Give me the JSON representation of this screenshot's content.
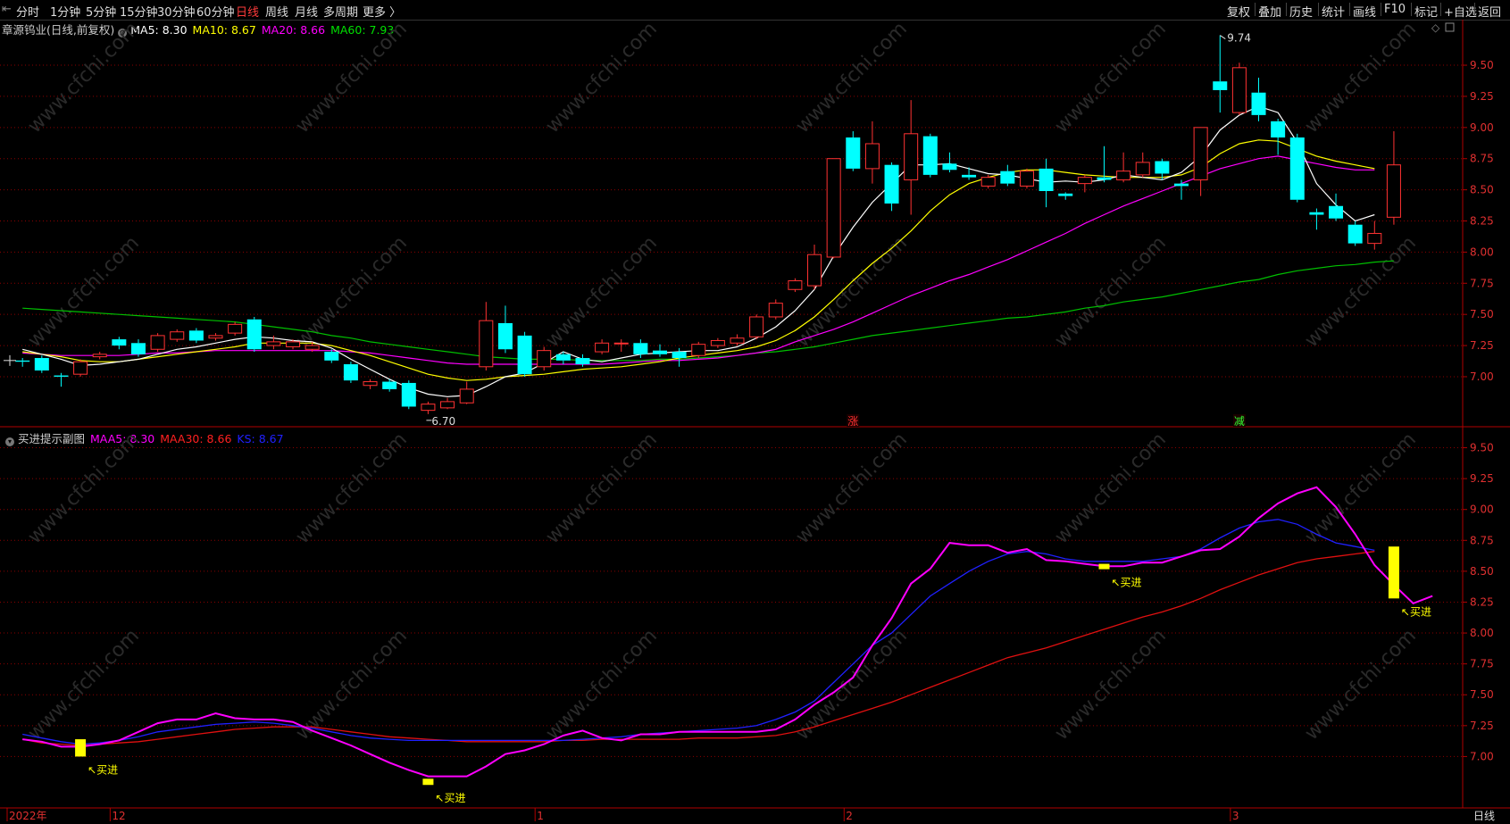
{
  "toolbar": {
    "left_tabs": [
      "分时",
      "1分钟",
      "5分钟",
      "15分钟",
      "30分钟",
      "60分钟",
      "日线",
      "周线",
      "月线",
      "多周期",
      "更多 〉"
    ],
    "active_tab": "日线",
    "right_tabs": [
      "复权",
      "叠加",
      "历史",
      "统计",
      "画线",
      "F10",
      "标记",
      "+自选",
      "返回"
    ]
  },
  "main_chart": {
    "stock_name": "章源钨业(日线,前复权)",
    "ma_labels": [
      {
        "text": "MA5: 8.30",
        "color": "#ffffff"
      },
      {
        "text": "MA10: 8.67",
        "color": "#ffff00"
      },
      {
        "text": "MA20: 8.66",
        "color": "#ff00ff"
      },
      {
        "text": "MA60: 7.93",
        "color": "#00e000"
      }
    ],
    "high_label": "9.74",
    "low_label": "6.70",
    "markers": [
      {
        "text": "涨",
        "color": "#ff3030",
        "bar": 43
      },
      {
        "text": "减",
        "color": "#30ff30",
        "bar": 63
      }
    ],
    "y_ticks": [
      "9.50",
      "9.25",
      "9.00",
      "8.75",
      "8.50",
      "8.25",
      "8.00",
      "7.75",
      "7.50",
      "7.25",
      "7.00"
    ],
    "icons": [
      "diamond-icon",
      "window-icon"
    ]
  },
  "sub_chart": {
    "title": "买进提示副图",
    "labels": [
      {
        "text": "MAA5: 8.30",
        "color": "#ff00ff"
      },
      {
        "text": "MAA30: 8.66",
        "color": "#ff2020"
      },
      {
        "text": "KS: 8.67",
        "color": "#2020ff"
      }
    ],
    "y_ticks": [
      "9.50",
      "9.25",
      "9.00",
      "8.75",
      "8.50",
      "8.25",
      "8.00",
      "7.75",
      "7.50",
      "7.25",
      "7.00"
    ],
    "buy_label": "↖买进"
  },
  "x_axis": {
    "labels": [
      {
        "text": "2022年",
        "bar": 0
      },
      {
        "text": "12",
        "bar": 5
      },
      {
        "text": "1",
        "bar": 27
      },
      {
        "text": "2",
        "bar": 43
      },
      {
        "text": "3",
        "bar": 63
      }
    ],
    "period_label": "日线"
  },
  "watermark": "www.cfchi.com",
  "colors": {
    "up": "#ff3232",
    "down": "#00ffff",
    "ma5": "#ffffff",
    "ma10": "#ffff00",
    "ma20": "#ff00ff",
    "ma60": "#00c000",
    "ks": "#2020ff",
    "buy": "#ffff00",
    "grid": "#8b0000"
  },
  "chart_data": {
    "type": "candlestick",
    "candles": [
      {
        "o": 7.13,
        "c": 7.12,
        "h": 7.15,
        "l": 7.08
      },
      {
        "o": 7.15,
        "c": 7.05,
        "h": 7.17,
        "l": 7.03
      },
      {
        "o": 7.01,
        "c": 7.0,
        "h": 7.03,
        "l": 6.92
      },
      {
        "o": 7.02,
        "c": 7.12,
        "h": 7.14,
        "l": 7.0
      },
      {
        "o": 7.16,
        "c": 7.18,
        "h": 7.2,
        "l": 7.14
      },
      {
        "o": 7.3,
        "c": 7.25,
        "h": 7.32,
        "l": 7.22
      },
      {
        "o": 7.27,
        "c": 7.18,
        "h": 7.3,
        "l": 7.16
      },
      {
        "o": 7.22,
        "c": 7.33,
        "h": 7.35,
        "l": 7.2
      },
      {
        "o": 7.3,
        "c": 7.36,
        "h": 7.38,
        "l": 7.28
      },
      {
        "o": 7.37,
        "c": 7.29,
        "h": 7.39,
        "l": 7.27
      },
      {
        "o": 7.31,
        "c": 7.33,
        "h": 7.35,
        "l": 7.29
      },
      {
        "o": 7.35,
        "c": 7.42,
        "h": 7.44,
        "l": 7.33
      },
      {
        "o": 7.46,
        "c": 7.22,
        "h": 7.48,
        "l": 7.2
      },
      {
        "o": 7.25,
        "c": 7.28,
        "h": 7.33,
        "l": 7.22
      },
      {
        "o": 7.24,
        "c": 7.28,
        "h": 7.3,
        "l": 7.22
      },
      {
        "o": 7.22,
        "c": 7.25,
        "h": 7.28,
        "l": 7.2
      },
      {
        "o": 7.2,
        "c": 7.13,
        "h": 7.22,
        "l": 7.11
      },
      {
        "o": 7.1,
        "c": 6.97,
        "h": 7.12,
        "l": 6.95
      },
      {
        "o": 6.93,
        "c": 6.96,
        "h": 6.98,
        "l": 6.9
      },
      {
        "o": 6.96,
        "c": 6.9,
        "h": 6.98,
        "l": 6.88
      },
      {
        "o": 6.95,
        "c": 6.76,
        "h": 6.97,
        "l": 6.74
      },
      {
        "o": 6.73,
        "c": 6.78,
        "h": 6.8,
        "l": 6.7
      },
      {
        "o": 6.75,
        "c": 6.8,
        "h": 6.83,
        "l": 6.74
      },
      {
        "o": 6.79,
        "c": 6.9,
        "h": 6.96,
        "l": 6.78
      },
      {
        "o": 7.08,
        "c": 7.45,
        "h": 7.6,
        "l": 7.05
      },
      {
        "o": 7.43,
        "c": 7.22,
        "h": 7.57,
        "l": 7.19
      },
      {
        "o": 7.33,
        "c": 7.02,
        "h": 7.36,
        "l": 7.0
      },
      {
        "o": 7.08,
        "c": 7.21,
        "h": 7.24,
        "l": 7.05
      },
      {
        "o": 7.18,
        "c": 7.13,
        "h": 7.2,
        "l": 7.1
      },
      {
        "o": 7.15,
        "c": 7.1,
        "h": 7.18,
        "l": 7.08
      },
      {
        "o": 7.2,
        "c": 7.27,
        "h": 7.3,
        "l": 7.18
      },
      {
        "o": 7.27,
        "c": 7.27,
        "h": 7.3,
        "l": 7.2
      },
      {
        "o": 7.27,
        "c": 7.18,
        "h": 7.3,
        "l": 7.15
      },
      {
        "o": 7.21,
        "c": 7.18,
        "h": 7.26,
        "l": 7.16
      },
      {
        "o": 7.2,
        "c": 7.15,
        "h": 7.23,
        "l": 7.08
      },
      {
        "o": 7.17,
        "c": 7.26,
        "h": 7.28,
        "l": 7.15
      },
      {
        "o": 7.25,
        "c": 7.29,
        "h": 7.31,
        "l": 7.23
      },
      {
        "o": 7.27,
        "c": 7.31,
        "h": 7.34,
        "l": 7.25
      },
      {
        "o": 7.32,
        "c": 7.48,
        "h": 7.5,
        "l": 7.3
      },
      {
        "o": 7.48,
        "c": 7.59,
        "h": 7.62,
        "l": 7.46
      },
      {
        "o": 7.7,
        "c": 7.77,
        "h": 7.79,
        "l": 7.68
      },
      {
        "o": 7.73,
        "c": 7.98,
        "h": 8.06,
        "l": 7.7
      },
      {
        "o": 7.96,
        "c": 8.75,
        "h": 8.75,
        "l": 7.95
      },
      {
        "o": 8.92,
        "c": 8.67,
        "h": 8.97,
        "l": 8.65
      },
      {
        "o": 8.67,
        "c": 8.87,
        "h": 9.05,
        "l": 8.55
      },
      {
        "o": 8.7,
        "c": 8.39,
        "h": 8.72,
        "l": 8.33
      },
      {
        "o": 8.58,
        "c": 8.95,
        "h": 9.22,
        "l": 8.3
      },
      {
        "o": 8.93,
        "c": 8.62,
        "h": 8.95,
        "l": 8.6
      },
      {
        "o": 8.71,
        "c": 8.66,
        "h": 8.8,
        "l": 8.64
      },
      {
        "o": 8.62,
        "c": 8.6,
        "h": 8.68,
        "l": 8.58
      },
      {
        "o": 8.53,
        "c": 8.6,
        "h": 8.62,
        "l": 8.51
      },
      {
        "o": 8.65,
        "c": 8.55,
        "h": 8.7,
        "l": 8.53
      },
      {
        "o": 8.53,
        "c": 8.65,
        "h": 8.67,
        "l": 8.51
      },
      {
        "o": 8.67,
        "c": 8.49,
        "h": 8.75,
        "l": 8.36
      },
      {
        "o": 8.47,
        "c": 8.45,
        "h": 8.48,
        "l": 8.42
      },
      {
        "o": 8.55,
        "c": 8.6,
        "h": 8.62,
        "l": 8.48
      },
      {
        "o": 8.6,
        "c": 8.58,
        "h": 8.85,
        "l": 8.56
      },
      {
        "o": 8.58,
        "c": 8.65,
        "h": 8.8,
        "l": 8.56
      },
      {
        "o": 8.62,
        "c": 8.72,
        "h": 8.8,
        "l": 8.6
      },
      {
        "o": 8.73,
        "c": 8.63,
        "h": 8.75,
        "l": 8.58
      },
      {
        "o": 8.55,
        "c": 8.53,
        "h": 8.58,
        "l": 8.42
      },
      {
        "o": 8.58,
        "c": 9.0,
        "h": 9.0,
        "l": 8.45
      },
      {
        "o": 9.37,
        "c": 9.3,
        "h": 9.74,
        "l": 9.12
      },
      {
        "o": 9.12,
        "c": 9.48,
        "h": 9.52,
        "l": 9.1
      },
      {
        "o": 9.28,
        "c": 9.1,
        "h": 9.4,
        "l": 9.05
      },
      {
        "o": 9.05,
        "c": 8.92,
        "h": 9.07,
        "l": 8.78
      },
      {
        "o": 8.92,
        "c": 8.42,
        "h": 8.95,
        "l": 8.4
      },
      {
        "o": 8.32,
        "c": 8.3,
        "h": 8.35,
        "l": 8.18
      },
      {
        "o": 8.37,
        "c": 8.27,
        "h": 8.47,
        "l": 8.25
      },
      {
        "o": 8.22,
        "c": 8.07,
        "h": 8.25,
        "l": 8.05
      },
      {
        "o": 8.07,
        "c": 8.15,
        "h": 8.25,
        "l": 8.02
      },
      {
        "o": 8.28,
        "c": 8.7,
        "h": 8.97,
        "l": 8.22
      }
    ],
    "ma5": [
      7.22,
      7.18,
      7.14,
      7.09,
      7.1,
      7.12,
      7.14,
      7.18,
      7.22,
      7.24,
      7.27,
      7.3,
      7.32,
      7.31,
      7.29,
      7.28,
      7.23,
      7.14,
      7.06,
      6.98,
      6.91,
      6.86,
      6.84,
      6.85,
      6.92,
      7.0,
      7.03,
      7.11,
      7.2,
      7.14,
      7.12,
      7.15,
      7.18,
      7.19,
      7.2,
      7.21,
      7.21,
      7.24,
      7.31,
      7.4,
      7.53,
      7.7,
      7.97,
      8.2,
      8.4,
      8.55,
      8.7,
      8.7,
      8.71,
      8.67,
      8.63,
      8.62,
      8.59,
      8.56,
      8.57,
      8.56,
      8.58,
      8.62,
      8.6,
      8.58,
      8.64,
      8.77,
      8.98,
      9.1,
      9.17,
      9.12,
      8.88,
      8.55,
      8.38,
      8.25,
      8.3
    ],
    "ma10": [
      7.2,
      7.18,
      7.16,
      7.13,
      7.12,
      7.12,
      7.14,
      7.16,
      7.18,
      7.2,
      7.22,
      7.24,
      7.27,
      7.27,
      7.27,
      7.27,
      7.25,
      7.21,
      7.17,
      7.12,
      7.07,
      7.02,
      6.99,
      6.97,
      6.98,
      7.0,
      7.01,
      7.02,
      7.04,
      7.06,
      7.07,
      7.08,
      7.1,
      7.12,
      7.15,
      7.17,
      7.19,
      7.21,
      7.24,
      7.29,
      7.37,
      7.48,
      7.62,
      7.77,
      7.91,
      8.03,
      8.17,
      8.33,
      8.46,
      8.55,
      8.6,
      8.64,
      8.66,
      8.66,
      8.64,
      8.62,
      8.61,
      8.6,
      8.6,
      8.6,
      8.62,
      8.68,
      8.79,
      8.87,
      8.9,
      8.89,
      8.83,
      8.77,
      8.73,
      8.7,
      8.67
    ],
    "ma20": [
      7.19,
      7.18,
      7.17,
      7.17,
      7.17,
      7.17,
      7.18,
      7.19,
      7.19,
      7.2,
      7.21,
      7.21,
      7.21,
      7.21,
      7.21,
      7.21,
      7.21,
      7.2,
      7.19,
      7.17,
      7.15,
      7.13,
      7.11,
      7.1,
      7.1,
      7.1,
      7.1,
      7.1,
      7.1,
      7.1,
      7.1,
      7.11,
      7.12,
      7.13,
      7.13,
      7.14,
      7.15,
      7.17,
      7.19,
      7.22,
      7.28,
      7.33,
      7.38,
      7.44,
      7.51,
      7.58,
      7.65,
      7.71,
      7.77,
      7.82,
      7.88,
      7.94,
      8.01,
      8.08,
      8.15,
      8.23,
      8.3,
      8.37,
      8.43,
      8.49,
      8.55,
      8.61,
      8.67,
      8.71,
      8.75,
      8.77,
      8.74,
      8.71,
      8.68,
      8.66,
      8.66
    ],
    "ma60": [
      7.55,
      7.54,
      7.53,
      7.52,
      7.51,
      7.5,
      7.49,
      7.48,
      7.47,
      7.46,
      7.45,
      7.44,
      7.42,
      7.4,
      7.38,
      7.36,
      7.33,
      7.31,
      7.28,
      7.26,
      7.24,
      7.22,
      7.2,
      7.18,
      7.16,
      7.15,
      7.14,
      7.14,
      7.14,
      7.13,
      7.13,
      7.13,
      7.13,
      7.14,
      7.14,
      7.15,
      7.16,
      7.17,
      7.19,
      7.2,
      7.22,
      7.24,
      7.27,
      7.3,
      7.33,
      7.35,
      7.37,
      7.39,
      7.41,
      7.43,
      7.45,
      7.47,
      7.48,
      7.5,
      7.52,
      7.55,
      7.57,
      7.6,
      7.62,
      7.64,
      7.67,
      7.7,
      7.73,
      7.76,
      7.78,
      7.82,
      7.85,
      7.87,
      7.89,
      7.9,
      7.92,
      7.93
    ],
    "maa5": [
      7.14,
      7.12,
      7.08,
      7.08,
      7.1,
      7.13,
      7.2,
      7.27,
      7.3,
      7.3,
      7.35,
      7.31,
      7.3,
      7.3,
      7.28,
      7.21,
      7.15,
      7.09,
      7.02,
      6.95,
      6.89,
      6.84,
      6.84,
      6.84,
      6.92,
      7.02,
      7.05,
      7.1,
      7.17,
      7.21,
      7.15,
      7.13,
      7.18,
      7.18,
      7.2,
      7.2,
      7.2,
      7.2,
      7.2,
      7.22,
      7.3,
      7.42,
      7.52,
      7.64,
      7.9,
      8.12,
      8.4,
      8.52,
      8.73,
      8.71,
      8.71,
      8.65,
      8.68,
      8.59,
      8.58,
      8.56,
      8.54,
      8.54,
      8.57,
      8.57,
      8.62,
      8.67,
      8.68,
      8.78,
      8.93,
      9.05,
      9.13,
      9.18,
      9.02,
      8.8,
      8.55,
      8.39,
      8.24,
      8.3
    ],
    "maa30": [
      7.14,
      7.11,
      7.1,
      7.09,
      7.1,
      7.11,
      7.12,
      7.14,
      7.16,
      7.18,
      7.2,
      7.22,
      7.23,
      7.24,
      7.24,
      7.24,
      7.22,
      7.2,
      7.18,
      7.16,
      7.15,
      7.14,
      7.13,
      7.12,
      7.12,
      7.12,
      7.12,
      7.12,
      7.13,
      7.13,
      7.14,
      7.14,
      7.14,
      7.14,
      7.14,
      7.15,
      7.15,
      7.15,
      7.16,
      7.17,
      7.2,
      7.24,
      7.29,
      7.34,
      7.39,
      7.44,
      7.5,
      7.56,
      7.62,
      7.68,
      7.74,
      7.8,
      7.84,
      7.88,
      7.93,
      7.98,
      8.03,
      8.08,
      8.13,
      8.17,
      8.22,
      8.28,
      8.35,
      8.41,
      8.47,
      8.52,
      8.57,
      8.6,
      8.62,
      8.64,
      8.66
    ],
    "ks": [
      7.18,
      7.15,
      7.12,
      7.1,
      7.11,
      7.13,
      7.16,
      7.2,
      7.22,
      7.24,
      7.26,
      7.27,
      7.28,
      7.27,
      7.25,
      7.23,
      7.2,
      7.17,
      7.15,
      7.14,
      7.13,
      7.13,
      7.13,
      7.13,
      7.13,
      7.13,
      7.13,
      7.13,
      7.13,
      7.14,
      7.15,
      7.16,
      7.18,
      7.19,
      7.2,
      7.21,
      7.22,
      7.23,
      7.25,
      7.3,
      7.36,
      7.45,
      7.6,
      7.75,
      7.9,
      8.0,
      8.15,
      8.3,
      8.4,
      8.5,
      8.58,
      8.64,
      8.66,
      8.64,
      8.6,
      8.58,
      8.58,
      8.58,
      8.58,
      8.6,
      8.62,
      8.68,
      8.77,
      8.85,
      8.9,
      8.92,
      8.88,
      8.8,
      8.73,
      8.7,
      8.67
    ],
    "buy_signals": [
      {
        "bar": 3,
        "top": 7.14,
        "bottom": 7.0
      },
      {
        "bar": 21,
        "top": 6.82,
        "bottom": 6.77
      },
      {
        "bar": 56,
        "top": 8.56,
        "bottom": 8.53
      },
      {
        "bar": 71,
        "top": 8.7,
        "bottom": 8.28
      }
    ],
    "ylim": [
      6.62,
      9.88
    ],
    "sub_ylim": [
      6.62,
      9.67
    ],
    "grid": true
  }
}
